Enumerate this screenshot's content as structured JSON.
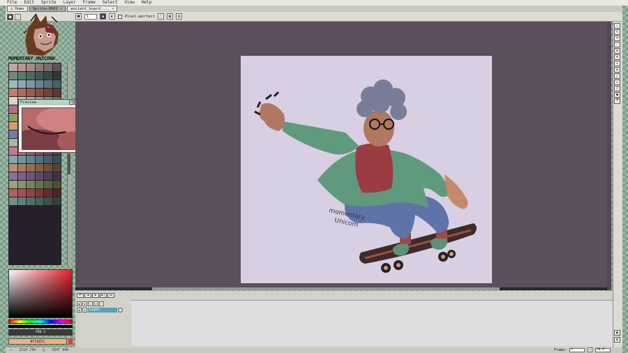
{
  "menu": [
    "File",
    "Edit",
    "Sprite",
    "Layer",
    "Frame",
    "Select",
    "View",
    "Help"
  ],
  "tabs": [
    {
      "label": "Home",
      "active": true
    },
    {
      "label": "Sprite-0001",
      "active": false
    },
    {
      "label": "ancient_board ...",
      "active": false
    }
  ],
  "context_bar": {
    "brush_size": "1",
    "pixel_perfect_label": "Pixel-perfect"
  },
  "brand": "MOMENTARY UNICORN",
  "preview": {
    "title": "Preview"
  },
  "color": {
    "hex": "f8b-1",
    "fg_label": "#f1b07c",
    "fg_hex": "#f1b07c"
  },
  "timeline": {
    "layer_name": "Layer",
    "controls": [
      "⏮",
      "◀",
      "▶",
      "▶|",
      "⏭"
    ]
  },
  "status": {
    "cursor": "1514 740",
    "size": "1047 940",
    "frame_label": "Frame:",
    "frame_value": "1",
    "zoom": "50.0"
  },
  "palette": [
    "#c5a49d",
    "#b8958d",
    "#a78c86",
    "#8e7a75",
    "#7a6c6a",
    "#5e5354",
    "#6b8b7b",
    "#5d7a6c",
    "#4e6a5e",
    "#405a50",
    "#344a43",
    "#283a35",
    "#9ab9c7",
    "#8aa8b6",
    "#7997a4",
    "#688592",
    "#577380",
    "#46626d",
    "#c37c6a",
    "#b06c5b",
    "#9c5d4f",
    "#874f43",
    "#734238",
    "#5f362e",
    "#dcd6c5",
    "#c8c1af",
    "#b3ac9a",
    "#9e9886",
    "#898472",
    "#74705f",
    "#b36d8c",
    "#9e5e7b",
    "#89506a",
    "#74435a",
    "#5f374a",
    "#4b2b3a",
    "#86a35c",
    "#759050",
    "#647d44",
    "#536a39",
    "#43572e",
    "#334423",
    "#d69d6c",
    "#c28b5d",
    "#ad7a4f",
    "#986942",
    "#845936",
    "#704a2b",
    "#6f7cb1",
    "#626e9d",
    "#555f89",
    "#485175",
    "#3b4362",
    "#2f354f",
    "#a7b6a3",
    "#96a592",
    "#849381",
    "#728170",
    "#61705f",
    "#505f4f",
    "#c67a8e",
    "#b26b7e",
    "#9d5d6f",
    "#884f60",
    "#734152",
    "#5f3444",
    "#7fa6b2",
    "#6f94a0",
    "#60838e",
    "#51727c",
    "#42606a",
    "#344f58",
    "#bc8f6a",
    "#a87f5d",
    "#947050",
    "#806044",
    "#6c5138",
    "#59432d",
    "#8a6f9e",
    "#7b628d",
    "#6c557c",
    "#5d486b",
    "#4e3c5a",
    "#40304a",
    "#99a577",
    "#899469",
    "#79835b",
    "#69724e",
    "#5a6141",
    "#4b5135",
    "#b65f5d",
    "#a25150",
    "#8e4444",
    "#7a3838",
    "#662c2d",
    "#532223",
    "#6d9287",
    "#5f8278",
    "#527269",
    "#45625a",
    "#39534c",
    "#2d443e"
  ]
}
